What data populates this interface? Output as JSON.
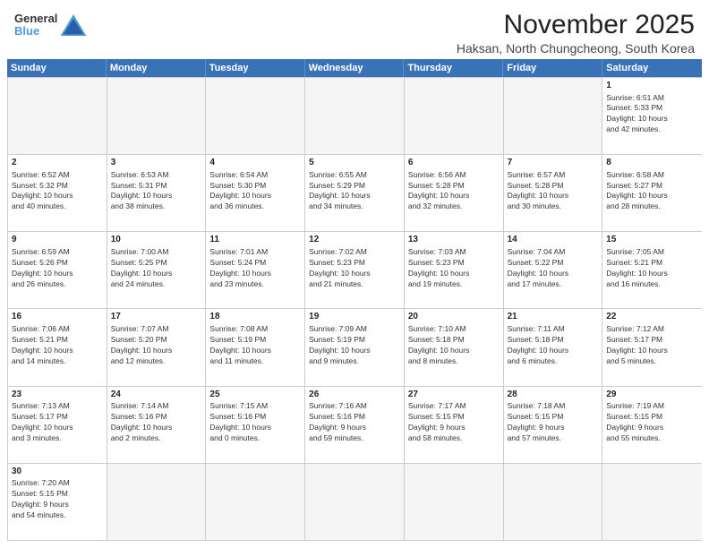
{
  "logo": {
    "line1": "General",
    "line2": "Blue"
  },
  "title": "November 2025",
  "subtitle": "Haksan, North Chungcheong, South Korea",
  "weekdays": [
    "Sunday",
    "Monday",
    "Tuesday",
    "Wednesday",
    "Thursday",
    "Friday",
    "Saturday"
  ],
  "weeks": [
    [
      {
        "day": "",
        "info": ""
      },
      {
        "day": "",
        "info": ""
      },
      {
        "day": "",
        "info": ""
      },
      {
        "day": "",
        "info": ""
      },
      {
        "day": "",
        "info": ""
      },
      {
        "day": "",
        "info": ""
      },
      {
        "day": "1",
        "info": "Sunrise: 6:51 AM\nSunset: 5:33 PM\nDaylight: 10 hours\nand 42 minutes."
      }
    ],
    [
      {
        "day": "2",
        "info": "Sunrise: 6:52 AM\nSunset: 5:32 PM\nDaylight: 10 hours\nand 40 minutes."
      },
      {
        "day": "3",
        "info": "Sunrise: 6:53 AM\nSunset: 5:31 PM\nDaylight: 10 hours\nand 38 minutes."
      },
      {
        "day": "4",
        "info": "Sunrise: 6:54 AM\nSunset: 5:30 PM\nDaylight: 10 hours\nand 36 minutes."
      },
      {
        "day": "5",
        "info": "Sunrise: 6:55 AM\nSunset: 5:29 PM\nDaylight: 10 hours\nand 34 minutes."
      },
      {
        "day": "6",
        "info": "Sunrise: 6:56 AM\nSunset: 5:28 PM\nDaylight: 10 hours\nand 32 minutes."
      },
      {
        "day": "7",
        "info": "Sunrise: 6:57 AM\nSunset: 5:28 PM\nDaylight: 10 hours\nand 30 minutes."
      },
      {
        "day": "8",
        "info": "Sunrise: 6:58 AM\nSunset: 5:27 PM\nDaylight: 10 hours\nand 28 minutes."
      }
    ],
    [
      {
        "day": "9",
        "info": "Sunrise: 6:59 AM\nSunset: 5:26 PM\nDaylight: 10 hours\nand 26 minutes."
      },
      {
        "day": "10",
        "info": "Sunrise: 7:00 AM\nSunset: 5:25 PM\nDaylight: 10 hours\nand 24 minutes."
      },
      {
        "day": "11",
        "info": "Sunrise: 7:01 AM\nSunset: 5:24 PM\nDaylight: 10 hours\nand 23 minutes."
      },
      {
        "day": "12",
        "info": "Sunrise: 7:02 AM\nSunset: 5:23 PM\nDaylight: 10 hours\nand 21 minutes."
      },
      {
        "day": "13",
        "info": "Sunrise: 7:03 AM\nSunset: 5:23 PM\nDaylight: 10 hours\nand 19 minutes."
      },
      {
        "day": "14",
        "info": "Sunrise: 7:04 AM\nSunset: 5:22 PM\nDaylight: 10 hours\nand 17 minutes."
      },
      {
        "day": "15",
        "info": "Sunrise: 7:05 AM\nSunset: 5:21 PM\nDaylight: 10 hours\nand 16 minutes."
      }
    ],
    [
      {
        "day": "16",
        "info": "Sunrise: 7:06 AM\nSunset: 5:21 PM\nDaylight: 10 hours\nand 14 minutes."
      },
      {
        "day": "17",
        "info": "Sunrise: 7:07 AM\nSunset: 5:20 PM\nDaylight: 10 hours\nand 12 minutes."
      },
      {
        "day": "18",
        "info": "Sunrise: 7:08 AM\nSunset: 5:19 PM\nDaylight: 10 hours\nand 11 minutes."
      },
      {
        "day": "19",
        "info": "Sunrise: 7:09 AM\nSunset: 5:19 PM\nDaylight: 10 hours\nand 9 minutes."
      },
      {
        "day": "20",
        "info": "Sunrise: 7:10 AM\nSunset: 5:18 PM\nDaylight: 10 hours\nand 8 minutes."
      },
      {
        "day": "21",
        "info": "Sunrise: 7:11 AM\nSunset: 5:18 PM\nDaylight: 10 hours\nand 6 minutes."
      },
      {
        "day": "22",
        "info": "Sunrise: 7:12 AM\nSunset: 5:17 PM\nDaylight: 10 hours\nand 5 minutes."
      }
    ],
    [
      {
        "day": "23",
        "info": "Sunrise: 7:13 AM\nSunset: 5:17 PM\nDaylight: 10 hours\nand 3 minutes."
      },
      {
        "day": "24",
        "info": "Sunrise: 7:14 AM\nSunset: 5:16 PM\nDaylight: 10 hours\nand 2 minutes."
      },
      {
        "day": "25",
        "info": "Sunrise: 7:15 AM\nSunset: 5:16 PM\nDaylight: 10 hours\nand 0 minutes."
      },
      {
        "day": "26",
        "info": "Sunrise: 7:16 AM\nSunset: 5:16 PM\nDaylight: 9 hours\nand 59 minutes."
      },
      {
        "day": "27",
        "info": "Sunrise: 7:17 AM\nSunset: 5:15 PM\nDaylight: 9 hours\nand 58 minutes."
      },
      {
        "day": "28",
        "info": "Sunrise: 7:18 AM\nSunset: 5:15 PM\nDaylight: 9 hours\nand 57 minutes."
      },
      {
        "day": "29",
        "info": "Sunrise: 7:19 AM\nSunset: 5:15 PM\nDaylight: 9 hours\nand 55 minutes."
      }
    ],
    [
      {
        "day": "30",
        "info": "Sunrise: 7:20 AM\nSunset: 5:15 PM\nDaylight: 9 hours\nand 54 minutes."
      },
      {
        "day": "",
        "info": ""
      },
      {
        "day": "",
        "info": ""
      },
      {
        "day": "",
        "info": ""
      },
      {
        "day": "",
        "info": ""
      },
      {
        "day": "",
        "info": ""
      },
      {
        "day": "",
        "info": ""
      }
    ]
  ]
}
